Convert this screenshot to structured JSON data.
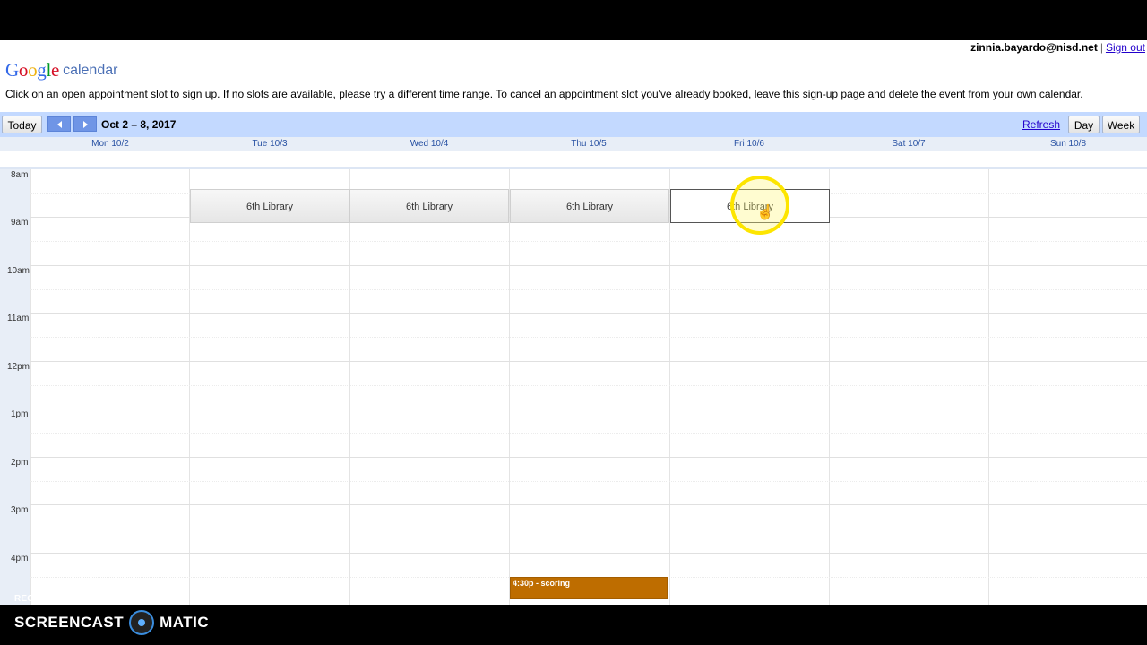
{
  "user": {
    "email": "zinnia.bayardo@nisd.net",
    "separator": "|",
    "signout": "Sign out"
  },
  "logo": {
    "google": "Google",
    "calendar": "calendar"
  },
  "instructions": "Click on an open appointment slot to sign up. If no slots are available, please try a different time range. To cancel an appointment slot you've already booked, leave this sign-up page and delete the event from your own calendar.",
  "nav": {
    "today": "Today",
    "range": "Oct 2 – 8, 2017",
    "refresh": "Refresh",
    "day": "Day",
    "week": "Week"
  },
  "days": [
    "Mon 10/2",
    "Tue 10/3",
    "Wed 10/4",
    "Thu 10/5",
    "Fri 10/6",
    "Sat 10/7",
    "Sun 10/8"
  ],
  "hours": [
    "8am",
    "9am",
    "10am",
    "11am",
    "12pm",
    "1pm",
    "2pm",
    "3pm",
    "4pm"
  ],
  "slots": [
    {
      "day": "Tue 10/3",
      "label": "6th Library"
    },
    {
      "day": "Wed 10/4",
      "label": "6th Library"
    },
    {
      "day": "Thu 10/5",
      "label": "6th Library"
    },
    {
      "day": "Fri 10/6",
      "label": "6th Library",
      "state": "hover"
    }
  ],
  "event": {
    "day": "Thu 10/5",
    "label": "4:30p - scoring",
    "color": "#be6d00"
  },
  "watermark": {
    "recorded": "RECORDED WITH",
    "brand_left": "SCREENCAST",
    "brand_right": "MATIC"
  },
  "colors": {
    "nav_bg": "#c3d9ff",
    "header_bg": "#e8eef7",
    "link": "#2200cc",
    "event": "#be6d00"
  }
}
